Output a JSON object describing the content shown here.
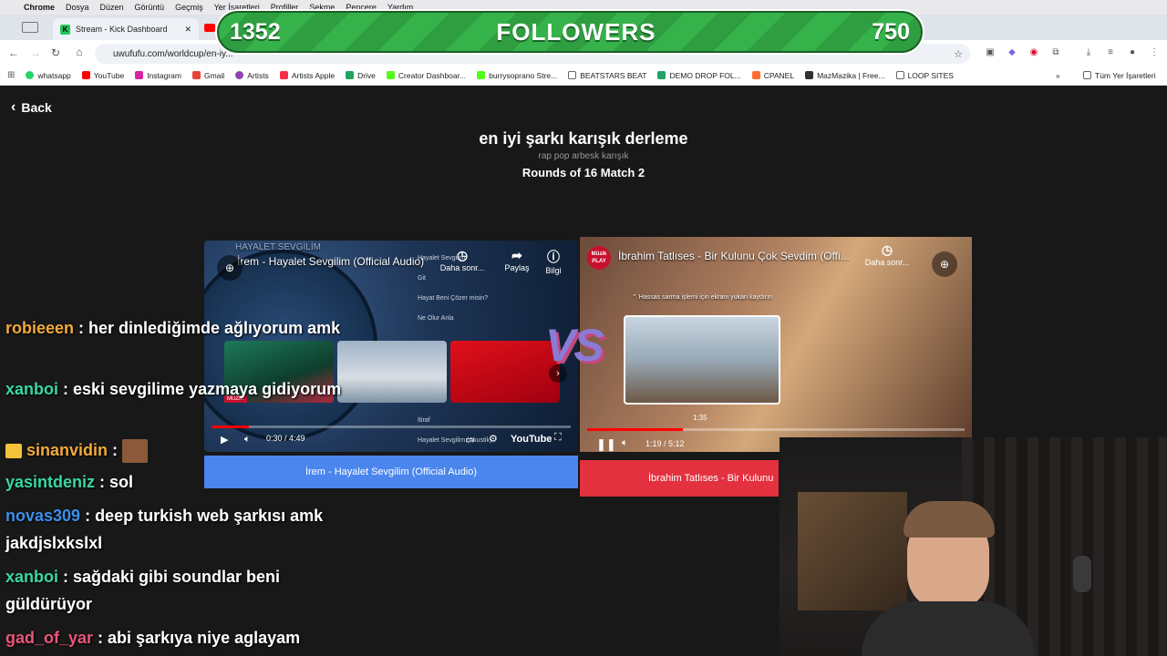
{
  "menubar": {
    "items": [
      "Chrome",
      "Dosya",
      "Düzen",
      "Görüntü",
      "Geçmiş",
      "Yer İşaretleri",
      "Profiller",
      "Sekme",
      "Pencere",
      "Yardım"
    ]
  },
  "tabs": [
    {
      "label": "Stream - Kick Dashboard",
      "icon": "kick-icon"
    }
  ],
  "address": {
    "url": "uwufufu.com/worldcup/en-iy..."
  },
  "bookmarks": [
    {
      "label": "whatsapp",
      "color": "#25d366"
    },
    {
      "label": "YouTube",
      "color": "#ff0000"
    },
    {
      "label": "Instagram",
      "color": "#d6249f"
    },
    {
      "label": "Gmail",
      "color": "#ea4335"
    },
    {
      "label": "Artists",
      "color": "#8e44ad"
    },
    {
      "label": "Artists Apple",
      "color": "#fa2d48"
    },
    {
      "label": "Drive",
      "color": "#1fa463"
    },
    {
      "label": "Creator Dashboar...",
      "color": "#53fc18"
    },
    {
      "label": "burrysoprano Stre...",
      "color": "#53fc18"
    },
    {
      "label": "BEATSTARS BEAT",
      "color": "#888888"
    },
    {
      "label": "DEMO DROP FOL...",
      "color": "#1fa463"
    },
    {
      "label": "CPANEL",
      "color": "#ff6c2c"
    },
    {
      "label": "MazMazika | Free...",
      "color": "#333333"
    },
    {
      "label": "LOOP SITES",
      "color": "#888888"
    }
  ],
  "bookmarks_other": "Tüm Yer İşaretleri",
  "followers": {
    "left": "1352",
    "label": "FOLLOWERS",
    "right": "750"
  },
  "page": {
    "back": "Back",
    "title": "en iyi şarkı karışık derleme",
    "subtitle": "rap pop arbesk karışık",
    "round": "Rounds of 16 Match 2"
  },
  "left_video": {
    "title": "İrem - Hayalet Sevgilim (Official Audio)",
    "channel_overlay": "HAYALET SEVGİLİM",
    "watch_later": "Daha sonr...",
    "share": "Paylaş",
    "info": "Bilgi",
    "playlist": [
      "Hayalet Sevgilim",
      "Git",
      "Hayat Beni Çözer misin?",
      "Ne Olur Anla",
      "İtiraf",
      "Hayalet Sevgilim (Akustik)"
    ],
    "time": "0:30 / 4:49",
    "progress": 0.104,
    "brand": "YouTube",
    "tag": "MÜZİK",
    "choice": "İrem - Hayalet Sevgilim (Official Audio)"
  },
  "right_video": {
    "title": "İbrahim Tatlıses - Bir Kulunu Çok Sevdim (Offi...",
    "watch_later": "Daha sonr...",
    "hint": "Hassas sarma işlemi için ekranı yukarı kaydırın",
    "preview_time": "1:35",
    "time": "1:19 / 5:12",
    "progress": 0.253,
    "logo": "Müzik PLAY",
    "choice": "İbrahim Tatlıses - Bir Kulunu"
  },
  "vs": "VS",
  "chat": [
    {
      "user": "robieeen",
      "color": "#f2a93b",
      "text": "her dinlediğimde ağlıyorum amk"
    },
    {
      "user": "xanboi",
      "color": "#3ad6a4",
      "text": "eski sevgilime yazmaya gidiyorum"
    },
    {
      "user": "sinanvidin",
      "color": "#f2a93b",
      "text": ""
    },
    {
      "user": "yasintdeniz",
      "color": "#3ad6a4",
      "text": "sol"
    },
    {
      "user": "novas309",
      "color": "#3b8fe8",
      "text": "deep turkish web şarkısı amk jakdjslxkslxl"
    },
    {
      "user": "xanboi",
      "color": "#3ad6a4",
      "text": "sağdaki gibi soundlar beni güldürüyor"
    },
    {
      "user": "gad_of_yar",
      "color": "#e8557a",
      "text": "abi şarkıya niye aglayam"
    }
  ]
}
